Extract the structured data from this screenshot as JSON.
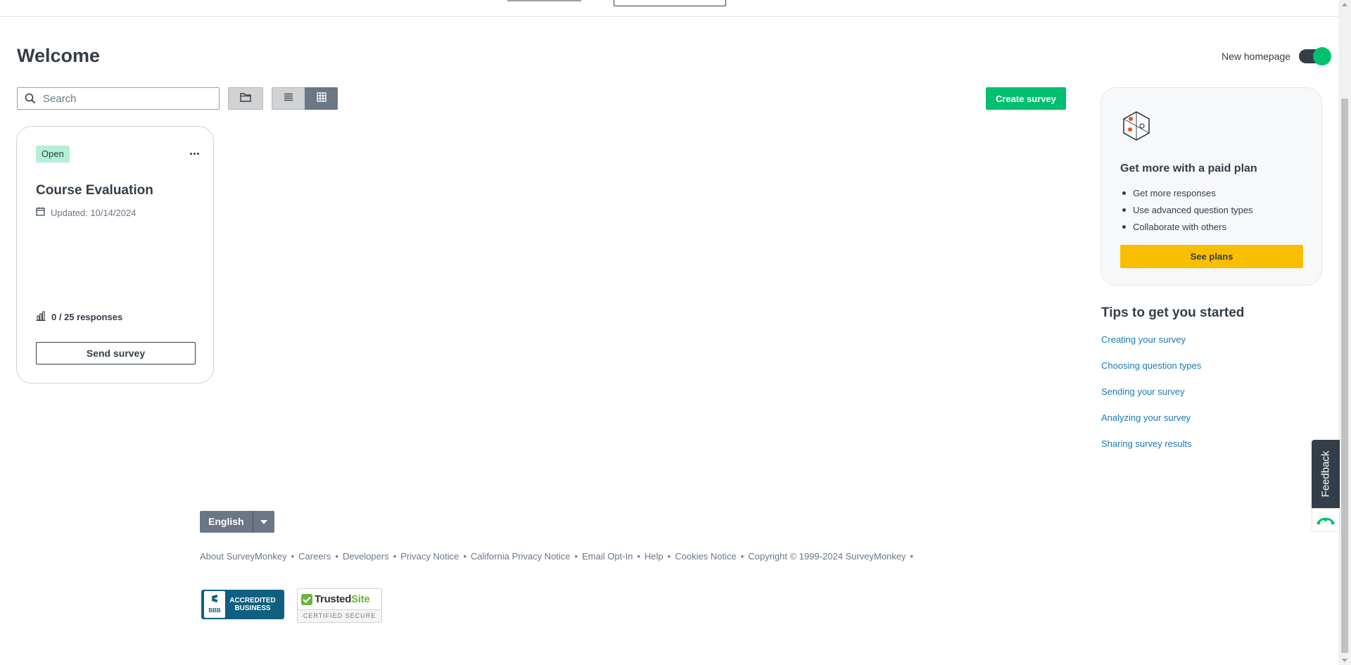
{
  "page": {
    "title": "Welcome",
    "new_homepage_label": "New homepage",
    "new_homepage_enabled": true
  },
  "toolbar": {
    "search_placeholder": "Search",
    "create_label": "Create survey",
    "active_view": "grid"
  },
  "survey_card": {
    "status": "Open",
    "title": "Course Evaluation",
    "updated": "Updated: 10/14/2024",
    "responses": "0 / 25 responses",
    "send_label": "Send survey"
  },
  "promo": {
    "title": "Get more with a paid plan",
    "items": [
      "Get more responses",
      "Use advanced question types",
      "Collaborate with others"
    ],
    "button_label": "See plans"
  },
  "tips": {
    "title": "Tips to get you started",
    "links": [
      "Creating your survey",
      "Choosing question types",
      "Sending your survey",
      "Analyzing your survey",
      "Sharing survey results"
    ]
  },
  "feedback": {
    "label": "Feedback"
  },
  "footer": {
    "language": "English",
    "links": [
      "About SurveyMonkey",
      "Careers",
      "Developers",
      "Privacy Notice",
      "California Privacy Notice",
      "Email Opt-In",
      "Help",
      "Cookies Notice",
      "Copyright © 1999-2024 SurveyMonkey"
    ],
    "bbb_badge_text": "ACCREDITED BUSINESS",
    "bbb_seal_text": "BBB",
    "trusted_name_a": "Trusted",
    "trusted_name_b": "Site",
    "trusted_sub": "CERTIFIED SECURE"
  },
  "colors": {
    "brand_green": "#00bf6f",
    "plans_yellow": "#f9be00",
    "link_blue": "#1b78b6",
    "text_dark": "#333e48"
  }
}
